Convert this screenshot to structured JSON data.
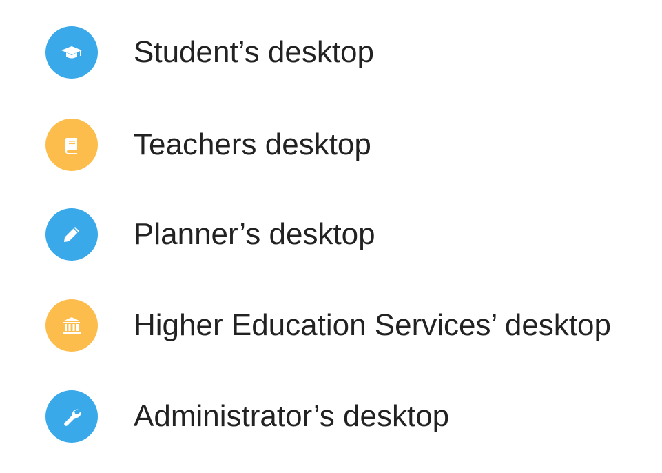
{
  "menu": {
    "items": [
      {
        "label": "Student’s desktop",
        "icon": "graduation-cap-icon",
        "color": "#3aa9ea"
      },
      {
        "label": "Teachers desktop",
        "icon": "book-icon",
        "color": "#fdbd4c"
      },
      {
        "label": "Planner’s desktop",
        "icon": "pencil-icon",
        "color": "#3aa9ea"
      },
      {
        "label": "Higher Education Services’ desktop",
        "icon": "institution-icon",
        "color": "#fdbd4c"
      },
      {
        "label": "Administrator’s desktop",
        "icon": "wrench-icon",
        "color": "#3aa9ea"
      }
    ]
  }
}
